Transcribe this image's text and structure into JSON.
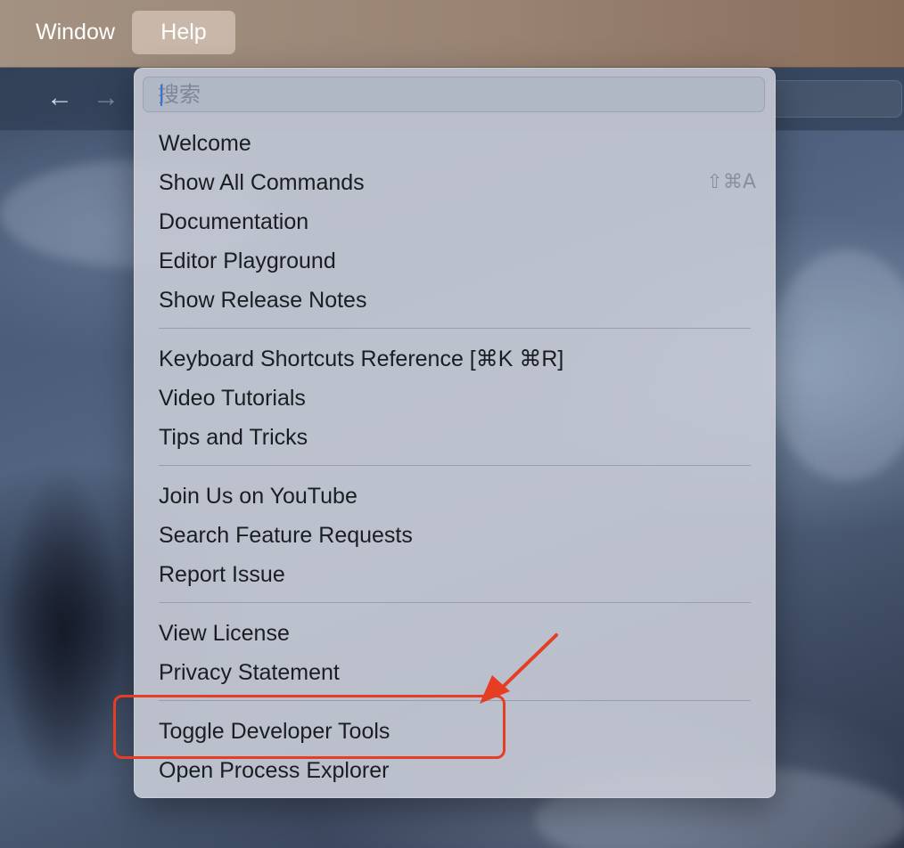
{
  "menubar": {
    "items": [
      {
        "label": "Window"
      },
      {
        "label": "Help"
      }
    ]
  },
  "toolbar": {
    "back_glyph": "←",
    "forward_glyph": "→"
  },
  "help_menu": {
    "search": {
      "placeholder": "搜索",
      "value": ""
    },
    "items": [
      {
        "label": "Welcome",
        "shortcut": ""
      },
      {
        "label": "Show All Commands",
        "shortcut": "⇧⌘A"
      },
      {
        "label": "Documentation",
        "shortcut": ""
      },
      {
        "label": "Editor Playground",
        "shortcut": ""
      },
      {
        "label": "Show Release Notes",
        "shortcut": ""
      },
      {
        "label": "Keyboard Shortcuts Reference [⌘K ⌘R]",
        "shortcut": ""
      },
      {
        "label": "Video Tutorials",
        "shortcut": ""
      },
      {
        "label": "Tips and Tricks",
        "shortcut": ""
      },
      {
        "label": "Join Us on YouTube",
        "shortcut": ""
      },
      {
        "label": "Search Feature Requests",
        "shortcut": ""
      },
      {
        "label": "Report Issue",
        "shortcut": ""
      },
      {
        "label": "View License",
        "shortcut": ""
      },
      {
        "label": "Privacy Statement",
        "shortcut": ""
      },
      {
        "label": "Toggle Developer Tools",
        "shortcut": ""
      },
      {
        "label": "Open Process Explorer",
        "shortcut": ""
      }
    ]
  },
  "annotation": {
    "color": "#e63e25",
    "highlighted_item": "Toggle Developer Tools"
  }
}
